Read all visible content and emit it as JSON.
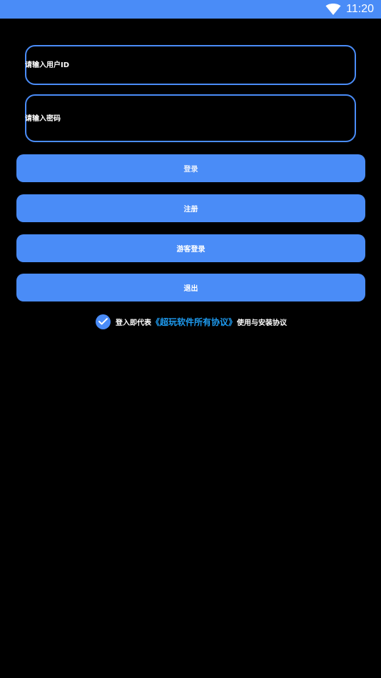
{
  "status_bar": {
    "time": "11:20",
    "icons": [
      "wifi-icon"
    ],
    "color": "#4a8cf7"
  },
  "form": {
    "user_id_placeholder": "请输入用户ID",
    "password_placeholder": "请输入密码"
  },
  "buttons": {
    "login": "登录",
    "register": "注册",
    "guest_login": "游客登录",
    "exit": "退出"
  },
  "agreement": {
    "checked": true,
    "prefix": "登入即代表",
    "link": "《超玩软件所有协议》",
    "suffix": "使用与安装协议",
    "link_color": "#1e9bf0"
  },
  "colors": {
    "accent": "#4a8cf7",
    "background": "#000000",
    "text": "#ffffff"
  }
}
